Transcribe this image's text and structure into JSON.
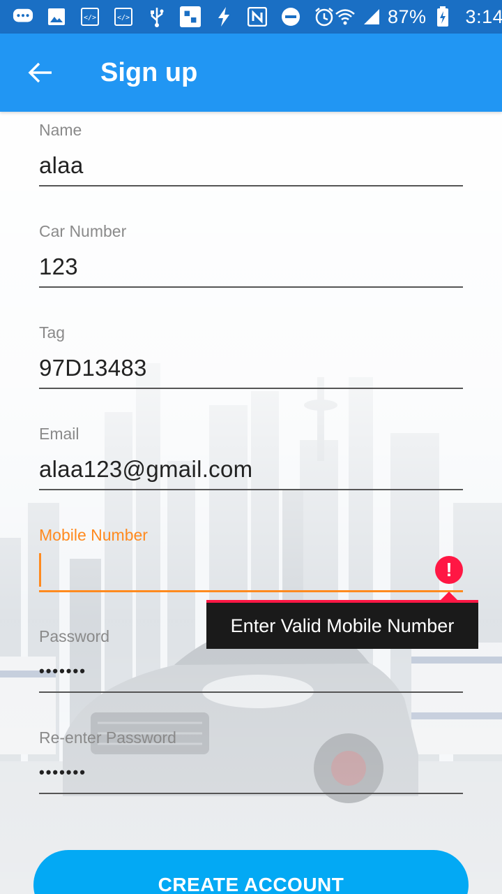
{
  "status_bar": {
    "battery": "87%",
    "time": "3:14",
    "icons": [
      "chat-icon",
      "image-icon",
      "code-icon",
      "code-icon",
      "usb-icon",
      "screenshot-icon",
      "flash-icon",
      "nfc-icon",
      "dnd-icon",
      "alarm-icon",
      "wifi-icon",
      "signal-icon",
      "battery-icon"
    ]
  },
  "app_bar": {
    "title": "Sign up",
    "background": "#2196f3",
    "back_icon": "arrow-left-icon"
  },
  "form": {
    "name": {
      "label": "Name",
      "value": "alaa"
    },
    "car_number": {
      "label": "Car Number",
      "value": "123"
    },
    "tag": {
      "label": "Tag",
      "value": "97D13483"
    },
    "email": {
      "label": "Email",
      "value": "alaa123@gmail.com"
    },
    "mobile": {
      "label": "Mobile Number",
      "value": "",
      "error": "Enter Valid Mobile Number"
    },
    "password": {
      "label": "Password",
      "value": "•••••••"
    },
    "reenter_password": {
      "label": "Re-enter Password",
      "value": "•••••••"
    }
  },
  "create_button": {
    "label": "CREATE ACCOUNT"
  },
  "colors": {
    "accent": "#ff8a1f",
    "error": "#ff1744",
    "button": "#03a9f4"
  }
}
